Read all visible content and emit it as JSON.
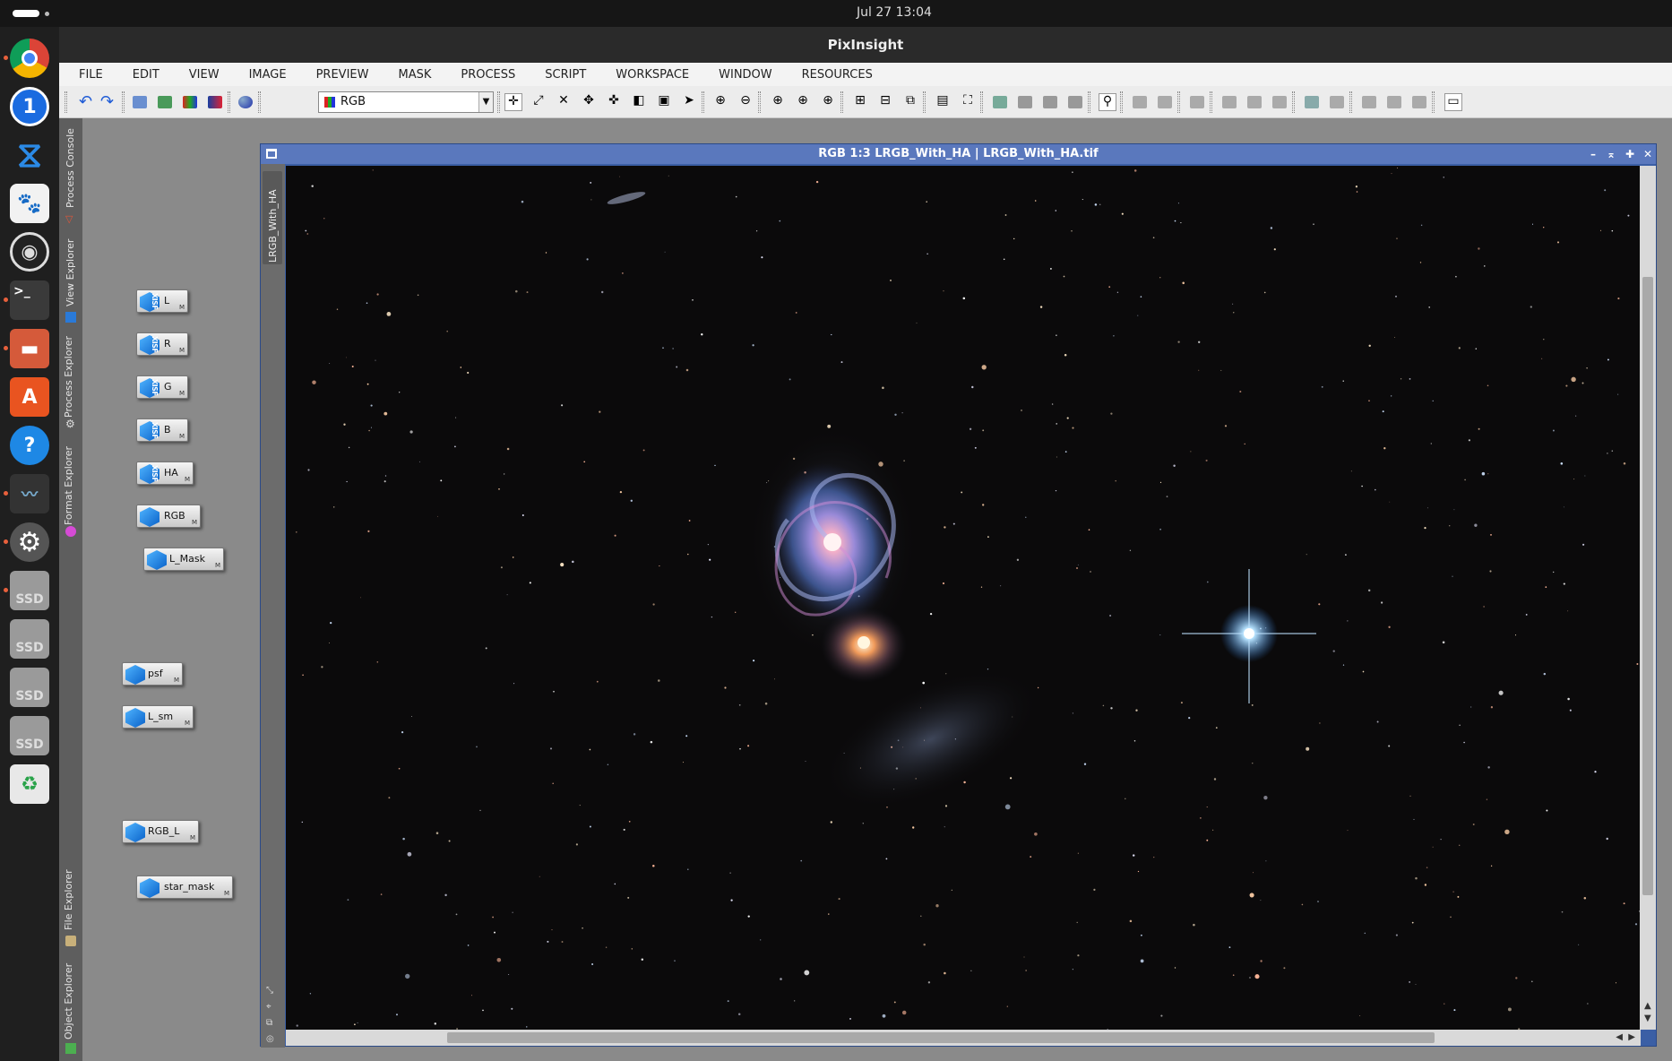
{
  "system_bar": {
    "clock": "Jul 27  13:04"
  },
  "dock": {
    "items": [
      {
        "name": "chrome",
        "color": "#e04a36"
      },
      {
        "name": "1password",
        "color": "#1a6be0"
      },
      {
        "name": "vscode",
        "color": "#2b8ae6"
      },
      {
        "name": "gimp",
        "color": "#8a6a4a"
      },
      {
        "name": "obs",
        "color": "#333333"
      },
      {
        "name": "terminal",
        "color": "#3a3a3a"
      },
      {
        "name": "files",
        "color": "#d55a3a"
      },
      {
        "name": "app-center",
        "color": "#e95420"
      },
      {
        "name": "help",
        "color": "#1e88e5"
      },
      {
        "name": "system-monitor",
        "color": "#333333"
      },
      {
        "name": "settings",
        "color": "#666666"
      },
      {
        "name": "ssd-1",
        "label": "SSD"
      },
      {
        "name": "ssd-2",
        "label": "SSD"
      },
      {
        "name": "ssd-3",
        "label": "SSD"
      },
      {
        "name": "ssd-4",
        "label": "SSD"
      },
      {
        "name": "trash",
        "color": "#2aa34a"
      }
    ]
  },
  "app": {
    "title": "PixInsight",
    "menu": [
      "FILE",
      "EDIT",
      "VIEW",
      "IMAGE",
      "PREVIEW",
      "MASK",
      "PROCESS",
      "SCRIPT",
      "WORKSPACE",
      "WINDOW",
      "RESOURCES"
    ],
    "toolbar": {
      "channel_combo": "RGB"
    },
    "side_tabs": [
      "Process Console",
      "View Explorer",
      "Process Explorer",
      "Format Explorer",
      "File Explorer",
      "Object Explorer"
    ]
  },
  "view_icons": [
    {
      "label": "L",
      "xisf": "XISF"
    },
    {
      "label": "R",
      "xisf": "XISF"
    },
    {
      "label": "G",
      "xisf": "XISF"
    },
    {
      "label": "B",
      "xisf": "XISF"
    },
    {
      "label": "HA",
      "xisf": "XISF"
    },
    {
      "label": "RGB"
    },
    {
      "label": "L_Mask"
    },
    {
      "label": "psf"
    },
    {
      "label": "L_sm"
    },
    {
      "label": "RGB_L"
    },
    {
      "label": "star_mask"
    }
  ],
  "image_window": {
    "title": "RGB 1:3 LRGB_With_HA | LRGB_With_HA.tif",
    "view_tab": "LRGB_With_HA",
    "buttons": [
      "minimize",
      "shade",
      "maximize",
      "close"
    ]
  }
}
